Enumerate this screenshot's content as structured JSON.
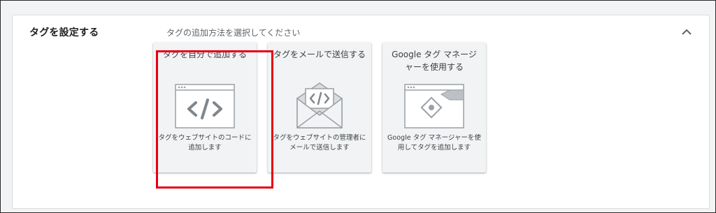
{
  "section": {
    "title": "タグを設定する",
    "subtitle": "タグの追加方法を選択してください"
  },
  "cards": [
    {
      "title": "タグを自分で追加する",
      "description": "タグをウェブサイトのコードに追加します",
      "icon": "code-icon",
      "selected": true
    },
    {
      "title": "タグをメールで送信する",
      "description": "タグをウェブサイトの管理者にメールで送信します",
      "icon": "email-code-icon",
      "selected": false
    },
    {
      "title": "Google タグ マネージャーを使用する",
      "description": "Google タグ マネージャーを使用してタグを追加します",
      "icon": "tag-manager-icon",
      "selected": false
    }
  ],
  "colors": {
    "highlight": "#e60012",
    "card_bg": "#f1f3f4",
    "panel_bg": "#ffffff"
  }
}
